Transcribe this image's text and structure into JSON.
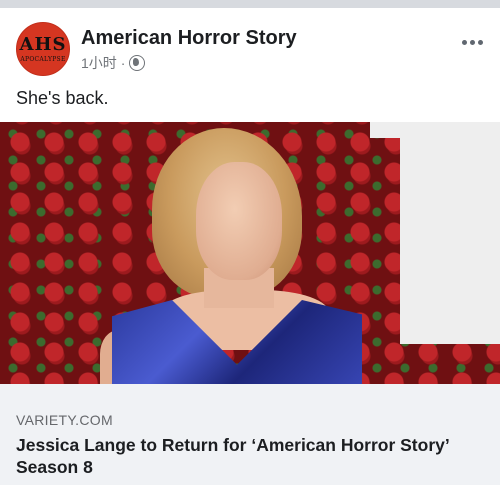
{
  "post": {
    "avatar": {
      "logo_text": "AHS",
      "logo_subtext": "APOCALYPSE",
      "color": "#d53621"
    },
    "page_name": "American Horror Story",
    "timestamp": "1小时",
    "separator": "·",
    "privacy_icon": "globe-icon",
    "more_icon": "more-options-icon",
    "text": "She's back."
  },
  "link_preview": {
    "domain": "VARIETY.COM",
    "title": "Jessica Lange to Return for ‘American Horror Story’ Season 8"
  },
  "colors": {
    "link_background": "#f0f2f5",
    "secondary_text": "#65676b",
    "primary_text": "#1c1e21"
  }
}
